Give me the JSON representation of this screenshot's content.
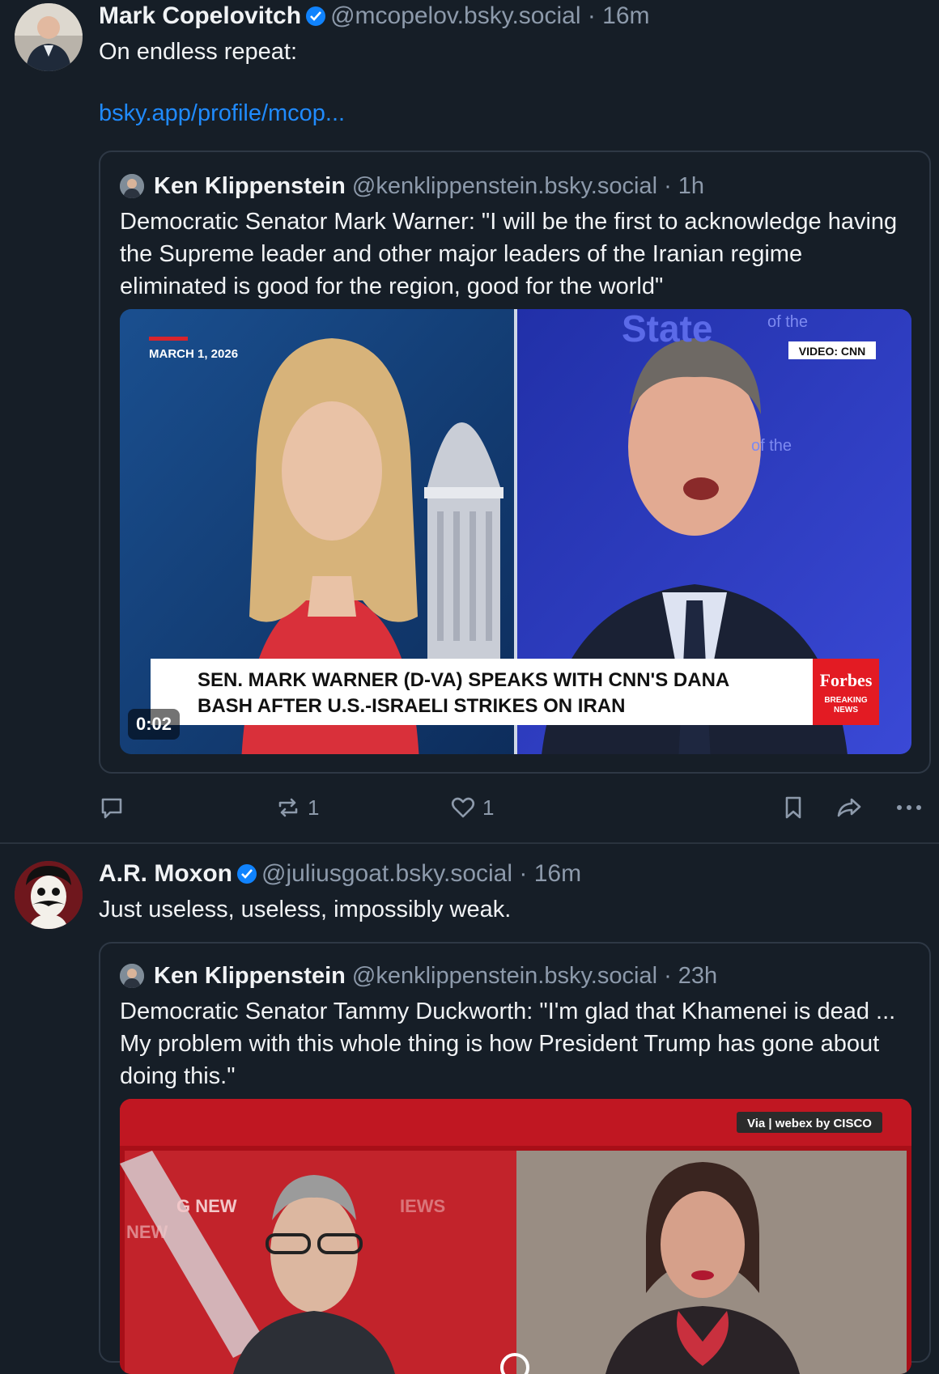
{
  "post1": {
    "author_name": "Mark Copelovitch",
    "handle": "@mcopelov.bsky.social",
    "time": "· 16m",
    "text": "On endless repeat:",
    "link": "bsky.app/profile/mcop...",
    "quote": {
      "author_name": "Ken Klippenstein",
      "handle": "@kenklippenstein.bsky.social",
      "time": "· 1h",
      "text": "Democratic Senator Mark Warner: \"I will be the first to acknowledge having the Supreme leader and other major leaders of the Iranian regime eliminated is good for the region, good for the world\"",
      "video": {
        "date": "MARCH 1, 2026",
        "credit": "VIDEO: CNN",
        "bg_word": "of the",
        "chyron_line1": "SEN. MARK WARNER (D-VA) SPEAKS WITH CNN'S DANA",
        "chyron_line2": "BASH AFTER U.S.-ISRAELI STRIKES ON IRAN",
        "brand": "Forbes",
        "brand_sub1": "BREAKING",
        "brand_sub2": "NEWS",
        "duration": "0:02"
      }
    },
    "actions": {
      "reply_count": "",
      "repost_count": "1",
      "like_count": "1"
    }
  },
  "post2": {
    "author_name": "A.R. Moxon",
    "handle": "@juliusgoat.bsky.social",
    "time": "· 16m",
    "text": "Just useless, useless, impossibly weak.",
    "quote": {
      "author_name": "Ken Klippenstein",
      "handle": "@kenklippenstein.bsky.social",
      "time": "· 23h",
      "text": "Democratic Senator Tammy Duckworth: \"I'm glad that Khamenei is dead ... My problem with this whole thing is how President Trump has gone about doing this.\"",
      "video": {
        "badge": "Via | webex by CISCO",
        "bg_text1": "G NEW",
        "bg_text2": "IEWS",
        "bg_text3": "NEW"
      }
    }
  },
  "colors": {
    "background": "#161e27",
    "accent": "#208bfe",
    "muted": "#8d9aab",
    "verified": "#1083fe"
  }
}
